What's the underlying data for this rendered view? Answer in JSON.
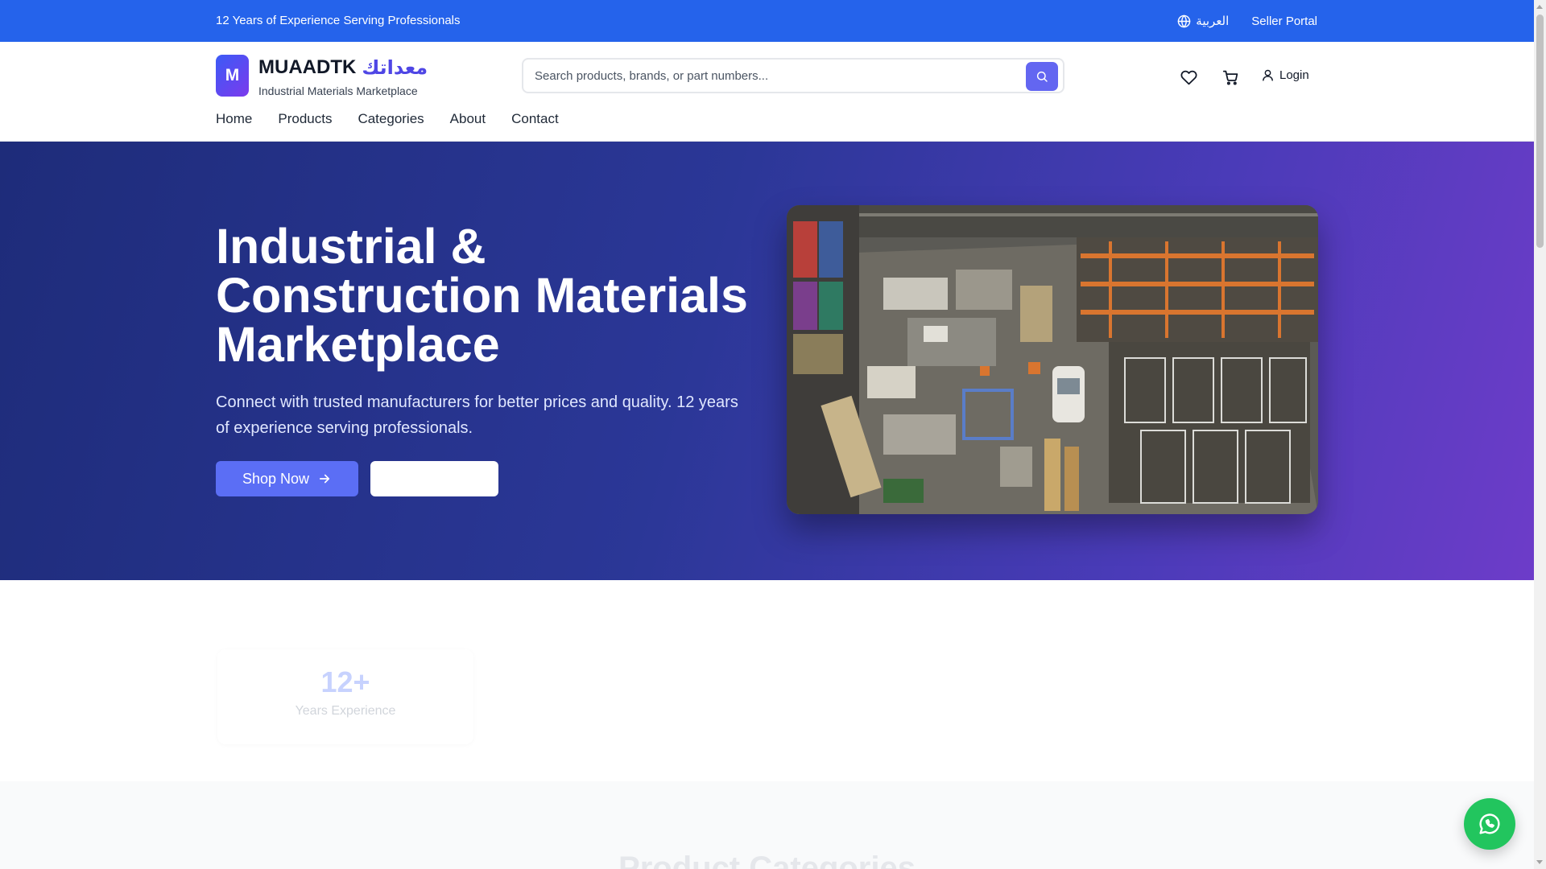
{
  "topbar": {
    "tagline": "12 Years of Experience Serving Professionals",
    "language_label": "العربية",
    "seller_portal": "Seller Portal"
  },
  "header": {
    "logo_letter": "M",
    "brand_en": "MUAADTK",
    "brand_ar": "معداتك",
    "brand_sub": "Industrial Materials Marketplace",
    "search_placeholder": "Search products, brands, or part numbers...",
    "login_label": "Login"
  },
  "nav": {
    "items": [
      "Home",
      "Products",
      "Categories",
      "About",
      "Contact"
    ]
  },
  "hero": {
    "title": "Industrial & Construction Materials Marketplace",
    "description": "Connect with trusted manufacturers for better prices and quality. 12 years of experience serving professionals.",
    "shop_button": "Shop Now",
    "image_icon": "warehouse-photo"
  },
  "stats": {
    "items": [
      {
        "value": "12+",
        "label": "Years Experience"
      }
    ]
  },
  "categories": {
    "title": "Product Categories"
  },
  "colors": {
    "primary": "#2563eb",
    "accent": "#6366f1",
    "whatsapp": "#22c55e"
  },
  "icons": [
    "globe-icon",
    "search-icon",
    "heart-icon",
    "cart-icon",
    "user-icon",
    "arrow-right-icon",
    "whatsapp-icon"
  ]
}
